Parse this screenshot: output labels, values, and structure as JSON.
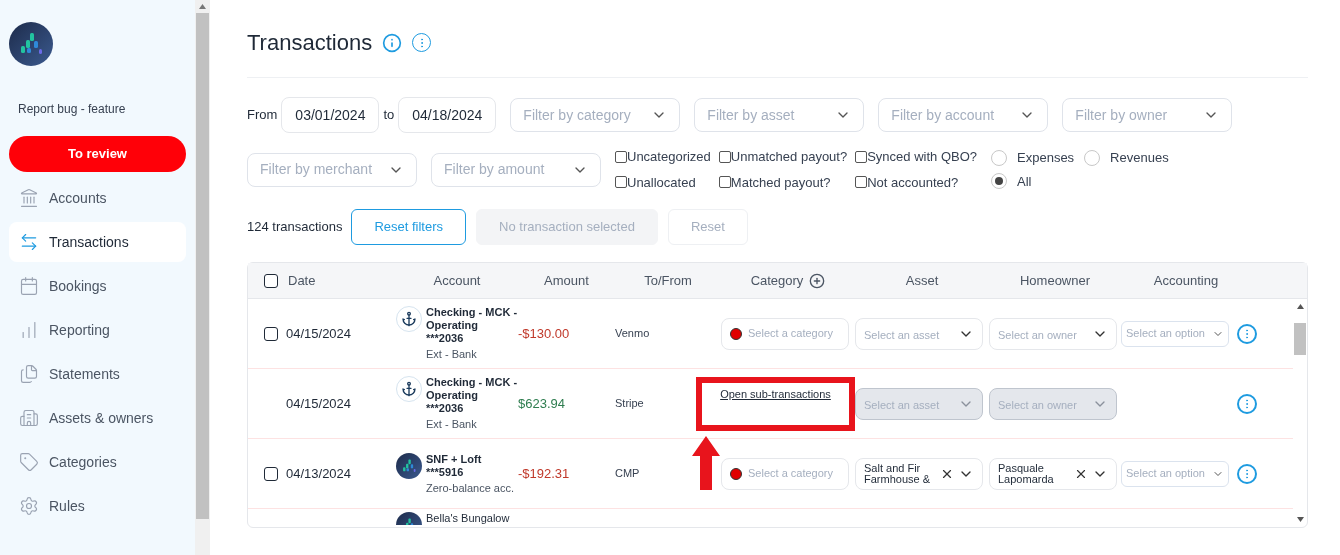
{
  "sidebar": {
    "report_link": "Report bug - feature",
    "review_button": "To review",
    "items": [
      {
        "label": "Accounts",
        "selected": false
      },
      {
        "label": "Transactions",
        "selected": true
      },
      {
        "label": "Bookings",
        "selected": false
      },
      {
        "label": "Reporting",
        "selected": false
      },
      {
        "label": "Statements",
        "selected": false
      },
      {
        "label": "Assets & owners",
        "selected": false
      },
      {
        "label": "Categories",
        "selected": false
      },
      {
        "label": "Rules",
        "selected": false
      }
    ]
  },
  "page": {
    "title": "Transactions"
  },
  "filters": {
    "from_label": "From",
    "from_date": "03/01/2024",
    "to_label": "to",
    "to_date": "04/18/2024",
    "dropdowns": [
      "Filter by category",
      "Filter by asset",
      "Filter by account",
      "Filter by owner",
      "Filter by merchant",
      "Filter by amount"
    ],
    "checkboxes": [
      {
        "label": "Uncategorized",
        "checked": false
      },
      {
        "label": "Unallocated",
        "checked": false
      },
      {
        "label": "Unmatched payout?",
        "checked": false
      },
      {
        "label": "Matched payout?",
        "checked": false
      },
      {
        "label": "Synced with QBO?",
        "checked": false
      },
      {
        "label": "Not accounted?",
        "checked": false
      }
    ],
    "radios": [
      {
        "label": "Expenses",
        "selected": false
      },
      {
        "label": "Revenues",
        "selected": false
      },
      {
        "label": "All",
        "selected": true
      }
    ]
  },
  "summary": {
    "count": "124 transactions",
    "buttons": [
      {
        "label": "Reset filters",
        "kind": "outline",
        "disabled": false
      },
      {
        "label": "No transaction selected",
        "kind": "filled",
        "disabled": true
      },
      {
        "label": "Reset",
        "kind": "plain",
        "disabled": true
      }
    ]
  },
  "table": {
    "select_all": {
      "checked": false
    },
    "columns": [
      {
        "label": "Date",
        "kind": "checkbox"
      },
      {
        "label": "Account",
        "kind": "text"
      },
      {
        "label": "Amount",
        "kind": "text"
      },
      {
        "label": "To/From",
        "kind": "text"
      },
      {
        "label": "Category",
        "kind": "add"
      },
      {
        "label": "Asset",
        "kind": "text"
      },
      {
        "label": "Homeowner",
        "kind": "text"
      },
      {
        "label": "Accounting",
        "kind": "text"
      }
    ],
    "rows": [
      {
        "selectable": true,
        "checked": false,
        "date": "04/15/2024",
        "account": {
          "kind": "anchor",
          "name": "Checking - MCK - Operating",
          "number": "***2036",
          "type": "Ext - Bank"
        },
        "amount": {
          "text": "-$130.00",
          "kind": "debit"
        },
        "to_from": "Venmo",
        "category": {
          "kind": "select",
          "placeholder": "Select a category",
          "color": "#e00000"
        },
        "asset": {
          "placeholder": "Select an asset",
          "disabled": false
        },
        "owner": {
          "placeholder": "Select an owner",
          "disabled": false
        },
        "accounting": {
          "placeholder": "Select an option"
        }
      },
      {
        "selectable": false,
        "date": "04/15/2024",
        "account": {
          "kind": "anchor",
          "name": "Checking - MCK - Operating",
          "number": "***2036",
          "type": "Ext - Bank"
        },
        "amount": {
          "text": "$623.94",
          "kind": "credit"
        },
        "to_from": "Stripe",
        "category": {
          "kind": "link",
          "label": "Open sub-transactions"
        },
        "asset": {
          "placeholder": "Select an asset",
          "disabled": true
        },
        "owner": {
          "placeholder": "Select an owner",
          "disabled": true
        }
      },
      {
        "selectable": true,
        "checked": false,
        "date": "04/13/2024",
        "account": {
          "kind": "app",
          "name": "SNF + Loft",
          "number": "***5916",
          "type": "Zero-balance acc."
        },
        "amount": {
          "text": "-$192.31",
          "kind": "debit"
        },
        "to_from": "CMP",
        "category": {
          "kind": "select",
          "placeholder": "Select a category",
          "color": "#e00000"
        },
        "asset": {
          "value": "Salt and Fir Farmhouse &",
          "disabled": false
        },
        "owner": {
          "value": "Pasquale Lapomarda",
          "disabled": false
        },
        "accounting": {
          "placeholder": "Select an option"
        }
      },
      {
        "partial": true,
        "account": {
          "kind": "app",
          "name": "Bella's Bungalow"
        }
      }
    ]
  }
}
